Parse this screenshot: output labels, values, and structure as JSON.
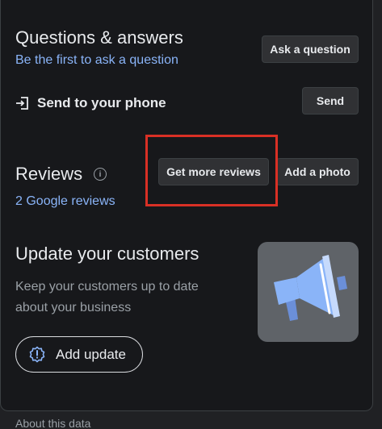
{
  "qa": {
    "title": "Questions & answers",
    "link": "Be the first to ask a question",
    "ask_button": "Ask a question"
  },
  "send": {
    "label": "Send to your phone",
    "button": "Send"
  },
  "reviews": {
    "title": "Reviews",
    "link": "2 Google reviews",
    "get_more_button": "Get more reviews",
    "add_photo_button": "Add a photo",
    "info_icon": "info-icon"
  },
  "update": {
    "title": "Update your customers",
    "description": "Keep your customers up to date about your business",
    "add_button": "Add update",
    "illustration_icon": "megaphone-icon"
  },
  "footer": {
    "about": "About this data"
  },
  "colors": {
    "panel_bg": "#17181b",
    "link": "#8ab4f8",
    "highlight": "#d93025",
    "illustration_bg": "#5f6368",
    "megaphone": "#8ab4f8"
  }
}
